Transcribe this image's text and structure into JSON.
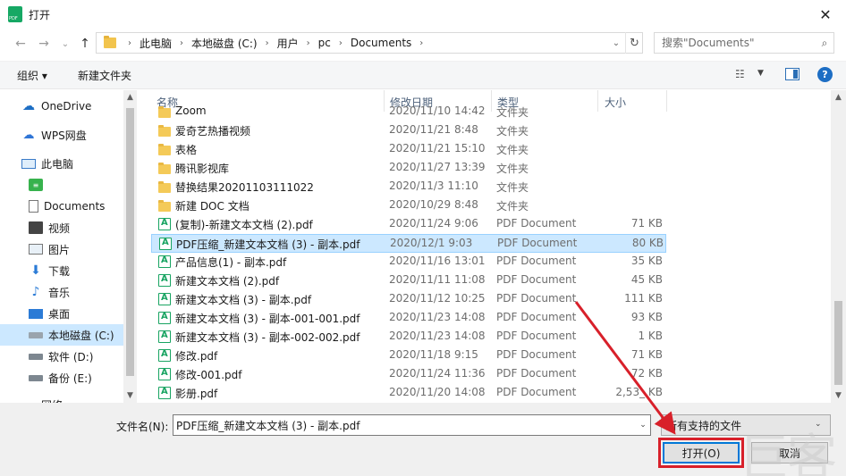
{
  "window": {
    "title": "打开",
    "close_glyph": "✕"
  },
  "address": {
    "crumbs": [
      "此电脑",
      "本地磁盘 (C:)",
      "用户",
      "pc",
      "Documents"
    ],
    "search_placeholder": "搜索\"Documents\""
  },
  "toolbar": {
    "organize_label": "组织 ▾",
    "new_folder_label": "新建文件夹"
  },
  "nav": {
    "items": [
      {
        "label": "OneDrive",
        "icon": "cloud-icon"
      },
      {
        "label": "WPS网盘",
        "icon": "wps-cloud-icon"
      },
      {
        "label": "此电脑",
        "icon": "computer-icon"
      },
      {
        "label": "",
        "icon": "green-app-icon"
      },
      {
        "label": "Documents",
        "icon": "document-icon"
      },
      {
        "label": "视频",
        "icon": "video-icon"
      },
      {
        "label": "图片",
        "icon": "picture-icon"
      },
      {
        "label": "下载",
        "icon": "download-icon"
      },
      {
        "label": "音乐",
        "icon": "music-icon"
      },
      {
        "label": "桌面",
        "icon": "desktop-icon"
      },
      {
        "label": "本地磁盘 (C:)",
        "icon": "drive-icon"
      },
      {
        "label": "软件 (D:)",
        "icon": "drive-icon"
      },
      {
        "label": "备份 (E:)",
        "icon": "drive-icon"
      },
      {
        "label": "网络",
        "icon": "network-icon"
      }
    ]
  },
  "columns": {
    "name": "名称",
    "date": "修改日期",
    "type": "类型",
    "size": "大小"
  },
  "files": [
    {
      "name": "Zoom",
      "date": "2020/11/10 14:42",
      "type": "文件夹",
      "size": "",
      "kind": "folder"
    },
    {
      "name": "爱奇艺热播视频",
      "date": "2020/11/21 8:48",
      "type": "文件夹",
      "size": "",
      "kind": "folder"
    },
    {
      "name": "表格",
      "date": "2020/11/21 15:10",
      "type": "文件夹",
      "size": "",
      "kind": "folder"
    },
    {
      "name": "腾讯影视库",
      "date": "2020/11/27 13:39",
      "type": "文件夹",
      "size": "",
      "kind": "folder"
    },
    {
      "name": "替换结果20201103111022",
      "date": "2020/11/3 11:10",
      "type": "文件夹",
      "size": "",
      "kind": "folder"
    },
    {
      "name": "新建 DOC 文档",
      "date": "2020/10/29 8:48",
      "type": "文件夹",
      "size": "",
      "kind": "folder"
    },
    {
      "name": "(复制)-新建文本文档 (2).pdf",
      "date": "2020/11/24 9:06",
      "type": "PDF Document",
      "size": "71 KB",
      "kind": "pdf"
    },
    {
      "name": "PDF压缩_新建文本文档 (3) - 副本.pdf",
      "date": "2020/12/1 9:03",
      "type": "PDF Document",
      "size": "80 KB",
      "kind": "pdf",
      "selected": true
    },
    {
      "name": "产品信息(1) - 副本.pdf",
      "date": "2020/11/16 13:01",
      "type": "PDF Document",
      "size": "35 KB",
      "kind": "pdf"
    },
    {
      "name": "新建文本文档 (2).pdf",
      "date": "2020/11/11 11:08",
      "type": "PDF Document",
      "size": "45 KB",
      "kind": "pdf"
    },
    {
      "name": "新建文本文档 (3) - 副本.pdf",
      "date": "2020/11/12 10:25",
      "type": "PDF Document",
      "size": "111 KB",
      "kind": "pdf"
    },
    {
      "name": "新建文本文档 (3) - 副本-001-001.pdf",
      "date": "2020/11/23 14:08",
      "type": "PDF Document",
      "size": "93 KB",
      "kind": "pdf"
    },
    {
      "name": "新建文本文档 (3) - 副本-002-002.pdf",
      "date": "2020/11/23 14:08",
      "type": "PDF Document",
      "size": "1 KB",
      "kind": "pdf"
    },
    {
      "name": "修改.pdf",
      "date": "2020/11/18 9:15",
      "type": "PDF Document",
      "size": "71 KB",
      "kind": "pdf"
    },
    {
      "name": "修改-001.pdf",
      "date": "2020/11/24 11:36",
      "type": "PDF Document",
      "size": "72 KB",
      "kind": "pdf"
    },
    {
      "name": "影册.pdf",
      "date": "2020/11/20 14:08",
      "type": "PDF Document",
      "size": "2,53_ KB",
      "kind": "pdf"
    }
  ],
  "bottom": {
    "filename_label": "文件名(N):",
    "filename_value": "PDF压缩_新建文本文档 (3) - 副本.pdf",
    "filetype_value": "所有支持的文件",
    "open_label": "打开(O)",
    "cancel_label": "取消"
  },
  "colors": {
    "selection": "#cce8ff",
    "annotation": "#d8202a",
    "accent": "#0078d7"
  }
}
